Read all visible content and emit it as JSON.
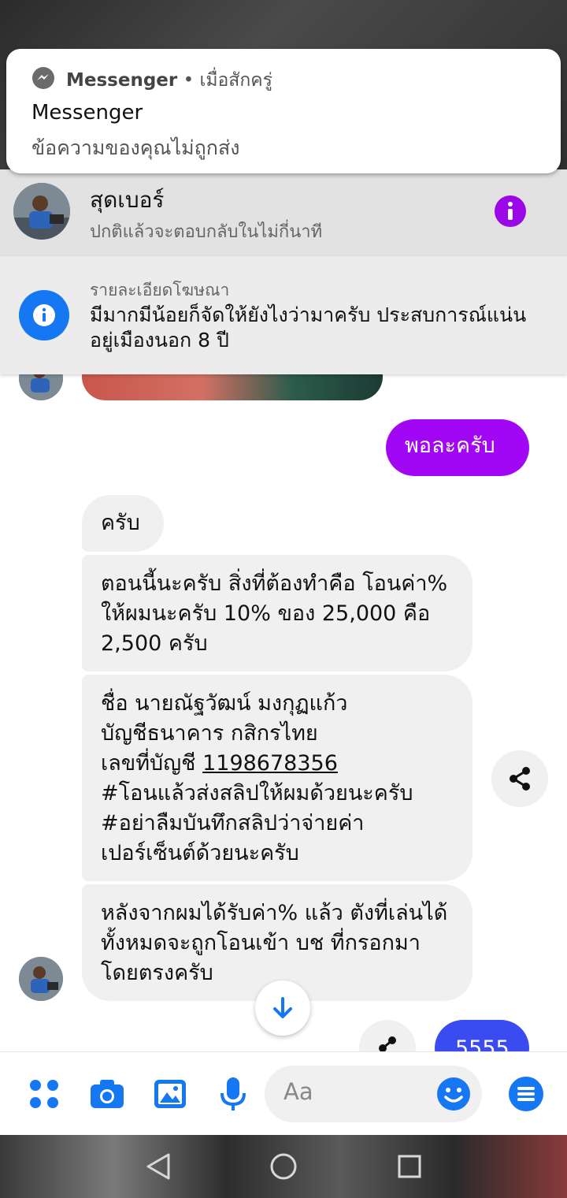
{
  "notification": {
    "app_name": "Messenger",
    "separator": "•",
    "time": "เมื่อสักครู่",
    "title": "Messenger",
    "text": "ข้อความของคุณไม่ถูกส่ง",
    "icon": "messenger-icon"
  },
  "header": {
    "name": "สุดเบอร์",
    "subtitle": "ปกติแล้วจะตอบกลับในไม่กี่นาที",
    "info_icon": "info-icon"
  },
  "ad_banner": {
    "label": "รายละเอียดโฆษณา",
    "text": "มีมากมีน้อยก็จัดให้ยังไงว่ามาครับ ประสบการณ์แน่นอยู่เมืองนอก 8 ปี",
    "icon": "info-icon"
  },
  "messages": {
    "sent_1": "พอละครับ",
    "recv_1": "ครับ",
    "recv_2": "ตอนนี้นะครับ สิ่งที่ต้องทำคือ โอนค่า% ให้ผมนะครับ 10% ของ 25,000 คือ 2,500 ครับ",
    "recv_3_line1": "ชื่อ นายณัฐวัฒน์ มงกุฏแก้ว",
    "recv_3_line2": "บัญชีธนาคาร กสิกรไทย",
    "recv_3_acct_label": "เลขที่บัญชี ",
    "recv_3_acct": "1198678356",
    "recv_3_line4": "#โอนแล้วส่งสลิปให้ผมด้วยนะครับ",
    "recv_3_line5": "#อย่าลืมบันทึกสลิปว่าจ่ายค่าเปอร์เซ็นต์ด้วยนะครับ",
    "recv_4": "หลังจากผมได้รับค่า% แล้ว ตังที่เล่นได้ทั้งหมดจะถูกโอนเข้า บช ที่กรอกมาโดยตรงครับ",
    "sent_2": "5555"
  },
  "composer": {
    "placeholder": "Aa",
    "icons": [
      "apps-icon",
      "camera-icon",
      "gallery-icon",
      "mic-icon",
      "emoji-icon",
      "menu-icon"
    ]
  },
  "colors": {
    "accent_purple": "#a106f5",
    "accent_blue": "#1677f2",
    "sent_blue": "#3a4cf0"
  }
}
